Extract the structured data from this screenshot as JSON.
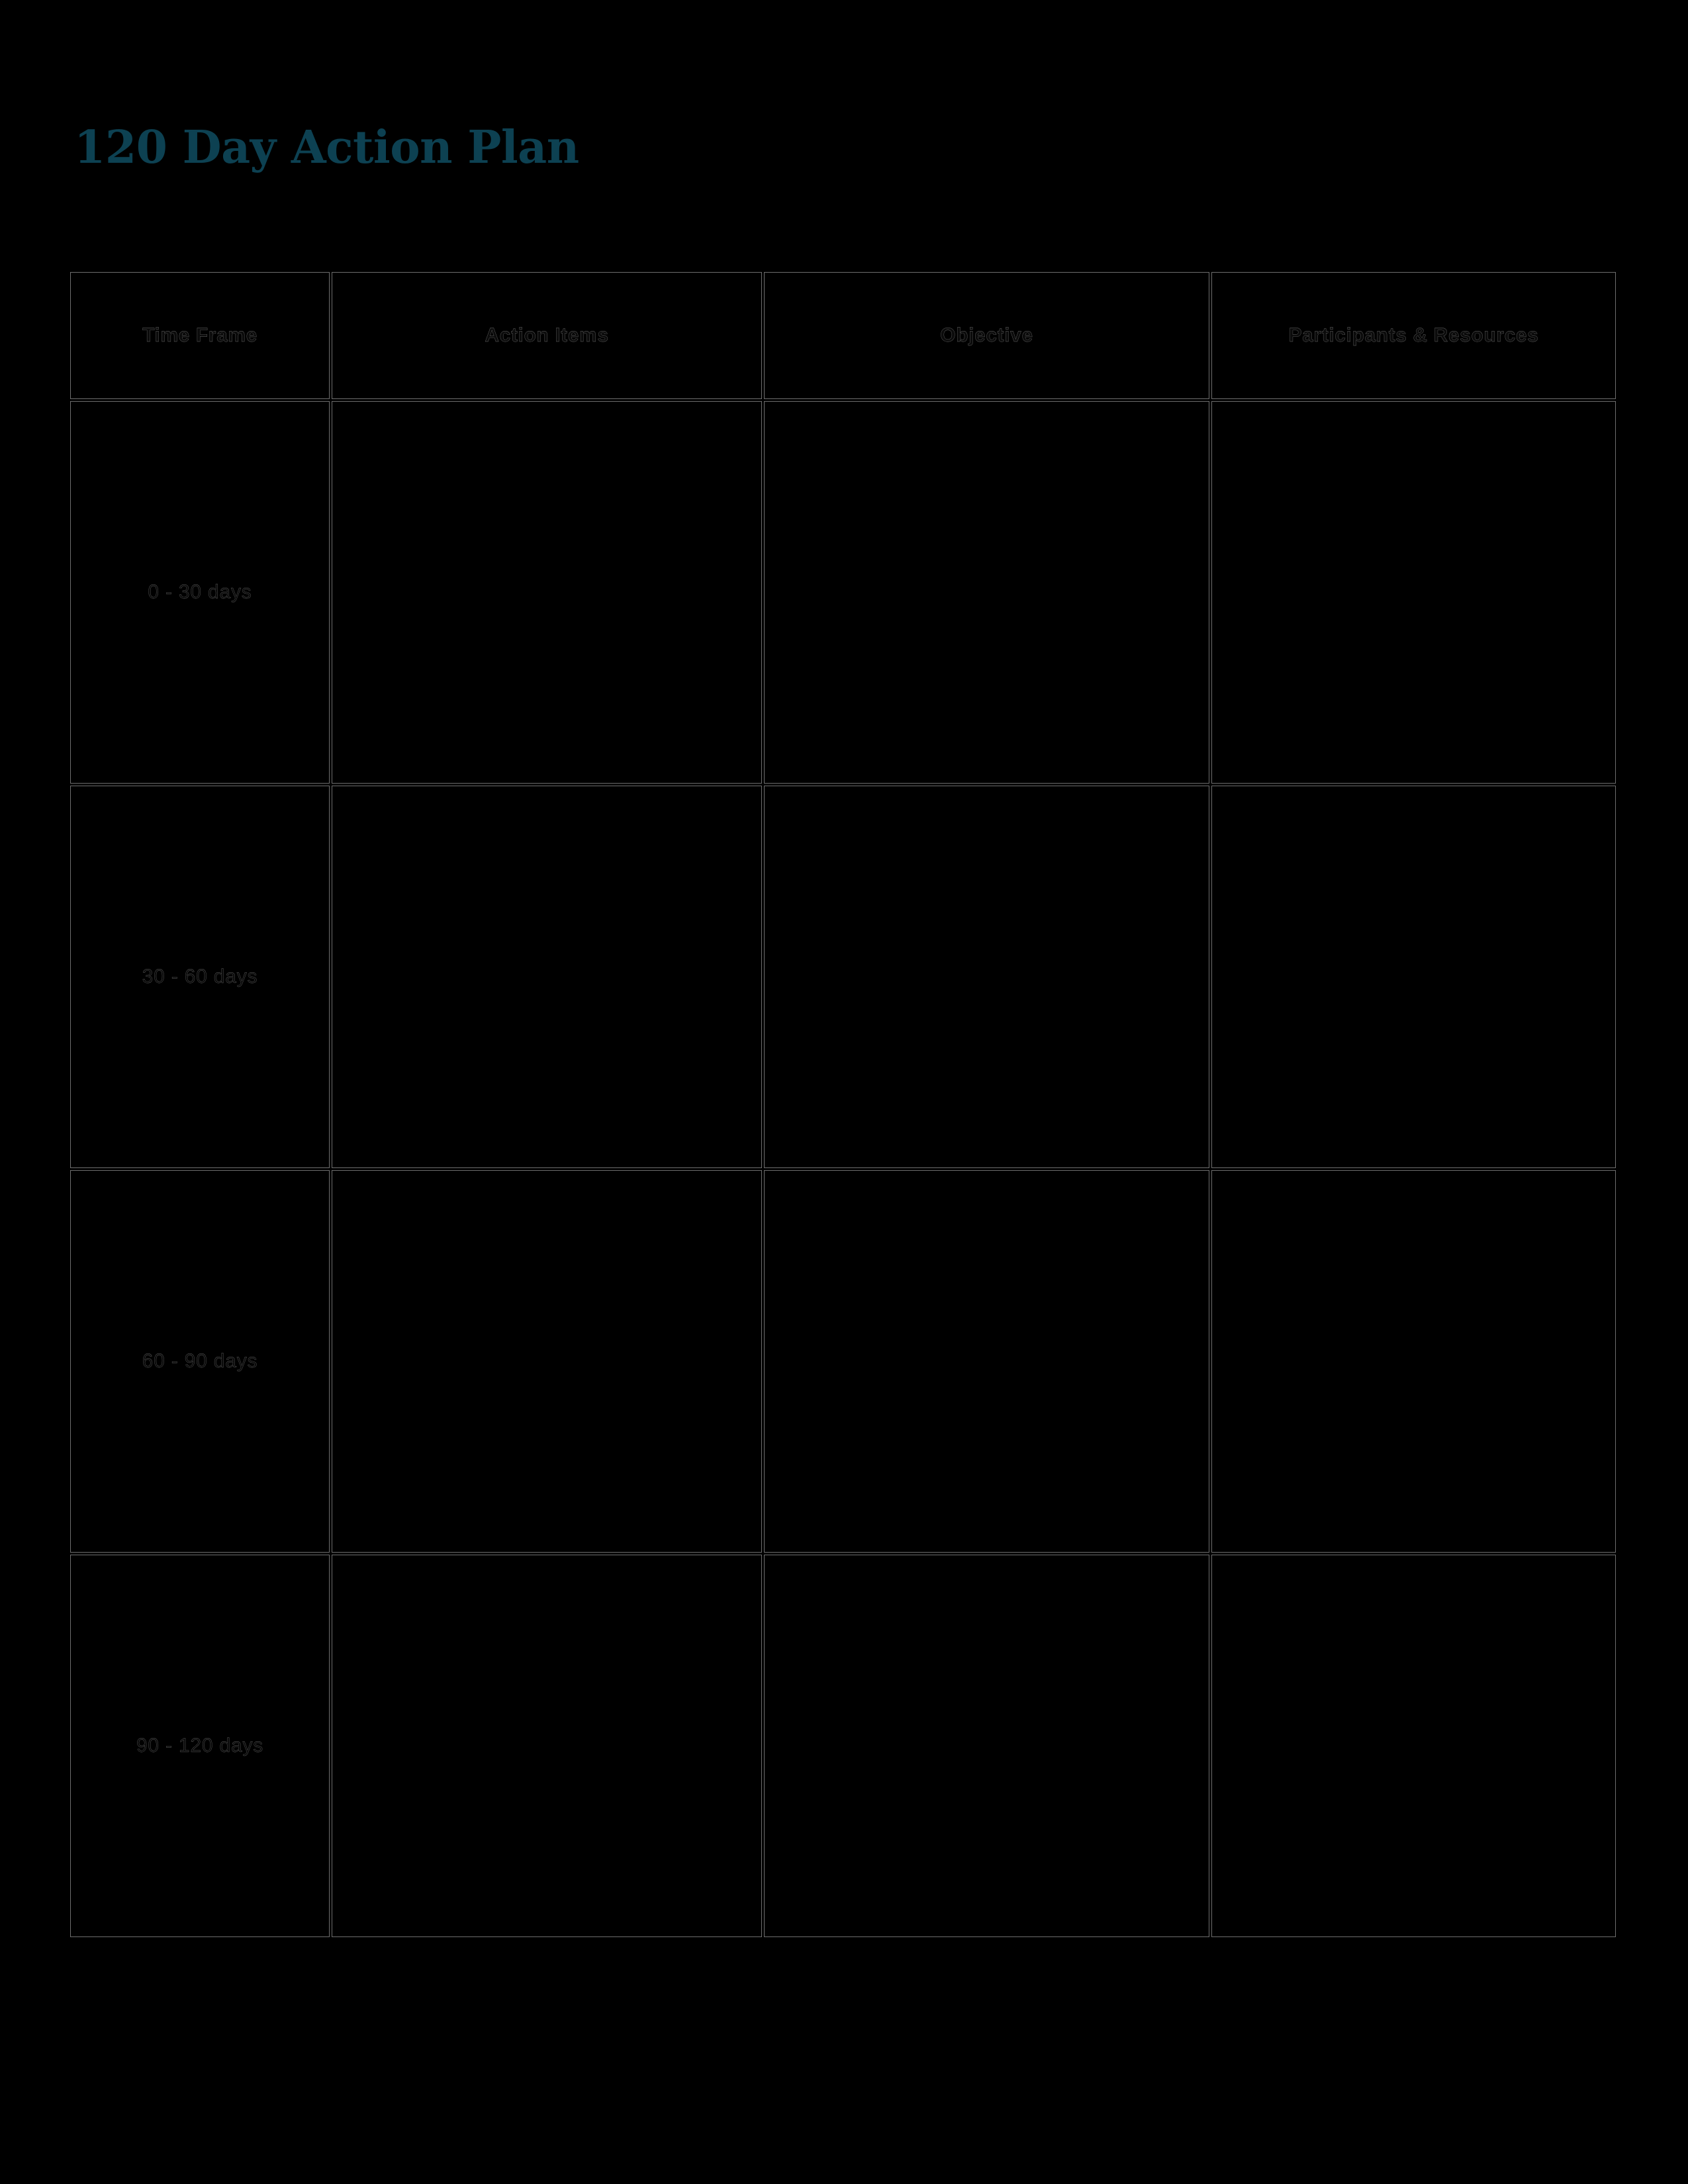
{
  "document": {
    "title": "120 Day Action Plan",
    "title_color": "#0d4152",
    "background_color": "#000000",
    "border_color": "#6e6e6e"
  },
  "table": {
    "name": "120-day-action-plan-table",
    "columns": [
      {
        "key": "time_frame",
        "label": "Time Frame"
      },
      {
        "key": "action_items",
        "label": "Action Items"
      },
      {
        "key": "objective",
        "label": "Objective"
      },
      {
        "key": "participants",
        "label": "Participants & Resources"
      }
    ],
    "rows": [
      {
        "time_frame": "0 - 30 days",
        "action_items": "",
        "objective": "",
        "participants": ""
      },
      {
        "time_frame": "30 - 60 days",
        "action_items": "",
        "objective": "",
        "participants": ""
      },
      {
        "time_frame": "60 - 90 days",
        "action_items": "",
        "objective": "",
        "participants": ""
      },
      {
        "time_frame": "90 - 120 days",
        "action_items": "",
        "objective": "",
        "participants": ""
      }
    ]
  }
}
